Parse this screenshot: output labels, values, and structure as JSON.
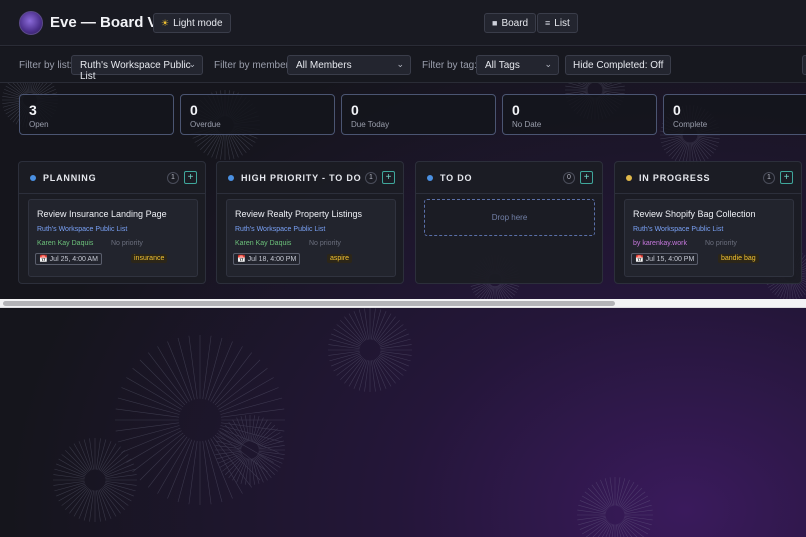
{
  "header": {
    "title": "Eve — Board View",
    "theme_button": "Light mode",
    "view_board": "Board",
    "view_list": "List"
  },
  "filters": {
    "list_label": "Filter by list:",
    "list_value": "Ruth's Workspace Public List",
    "member_label": "Filter by member:",
    "member_value": "All Members",
    "tag_label": "Filter by tag:",
    "tag_value": "All Tags",
    "hide_completed": "Hide Completed: Off"
  },
  "stats": [
    {
      "value": "3",
      "label": "Open"
    },
    {
      "value": "0",
      "label": "Overdue"
    },
    {
      "value": "0",
      "label": "Due Today"
    },
    {
      "value": "0",
      "label": "No Date"
    },
    {
      "value": "0",
      "label": "Complete"
    }
  ],
  "columns": [
    {
      "title": "PLANNING",
      "count": "1",
      "dot_color": "#4a90e2",
      "card": {
        "title": "Review Insurance Landing Page",
        "list": "Ruth's Workspace Public List",
        "member": "Karen Kay Daquis",
        "member_color": "#6cc07a",
        "priority": "No priority",
        "date": "Jul 25, 4:00 AM",
        "tag": "insurance"
      }
    },
    {
      "title": "HIGH PRIORITY - TO DO",
      "count": "1",
      "dot_color": "#4a90e2",
      "card": {
        "title": "Review Realty Property Listings",
        "list": "Ruth's Workspace Public List",
        "member": "Karen Kay Daquis",
        "member_color": "#6cc07a",
        "priority": "No priority",
        "date": "Jul 18, 4:00 PM",
        "tag": "aspire"
      }
    },
    {
      "title": "TO DO",
      "count": "0",
      "dot_color": "#4a90e2",
      "drop_text": "Drop here"
    },
    {
      "title": "IN PROGRESS",
      "count": "1",
      "dot_color": "#e0b84a",
      "card": {
        "title": "Review Shopify Bag Collection",
        "list": "Ruth's Workspace Public List",
        "member": "by karenkay.work",
        "member_color": "#c678dd",
        "priority": "No priority",
        "date": "Jul 15, 4:00 PM",
        "tag": "bandie bag"
      }
    }
  ],
  "icons": {
    "theme": "sun-icon",
    "board": "board-icon",
    "list": "list-icon",
    "calendar": "calendar-icon",
    "dropdown": "chevron-down-icon",
    "add": "plus-icon"
  }
}
